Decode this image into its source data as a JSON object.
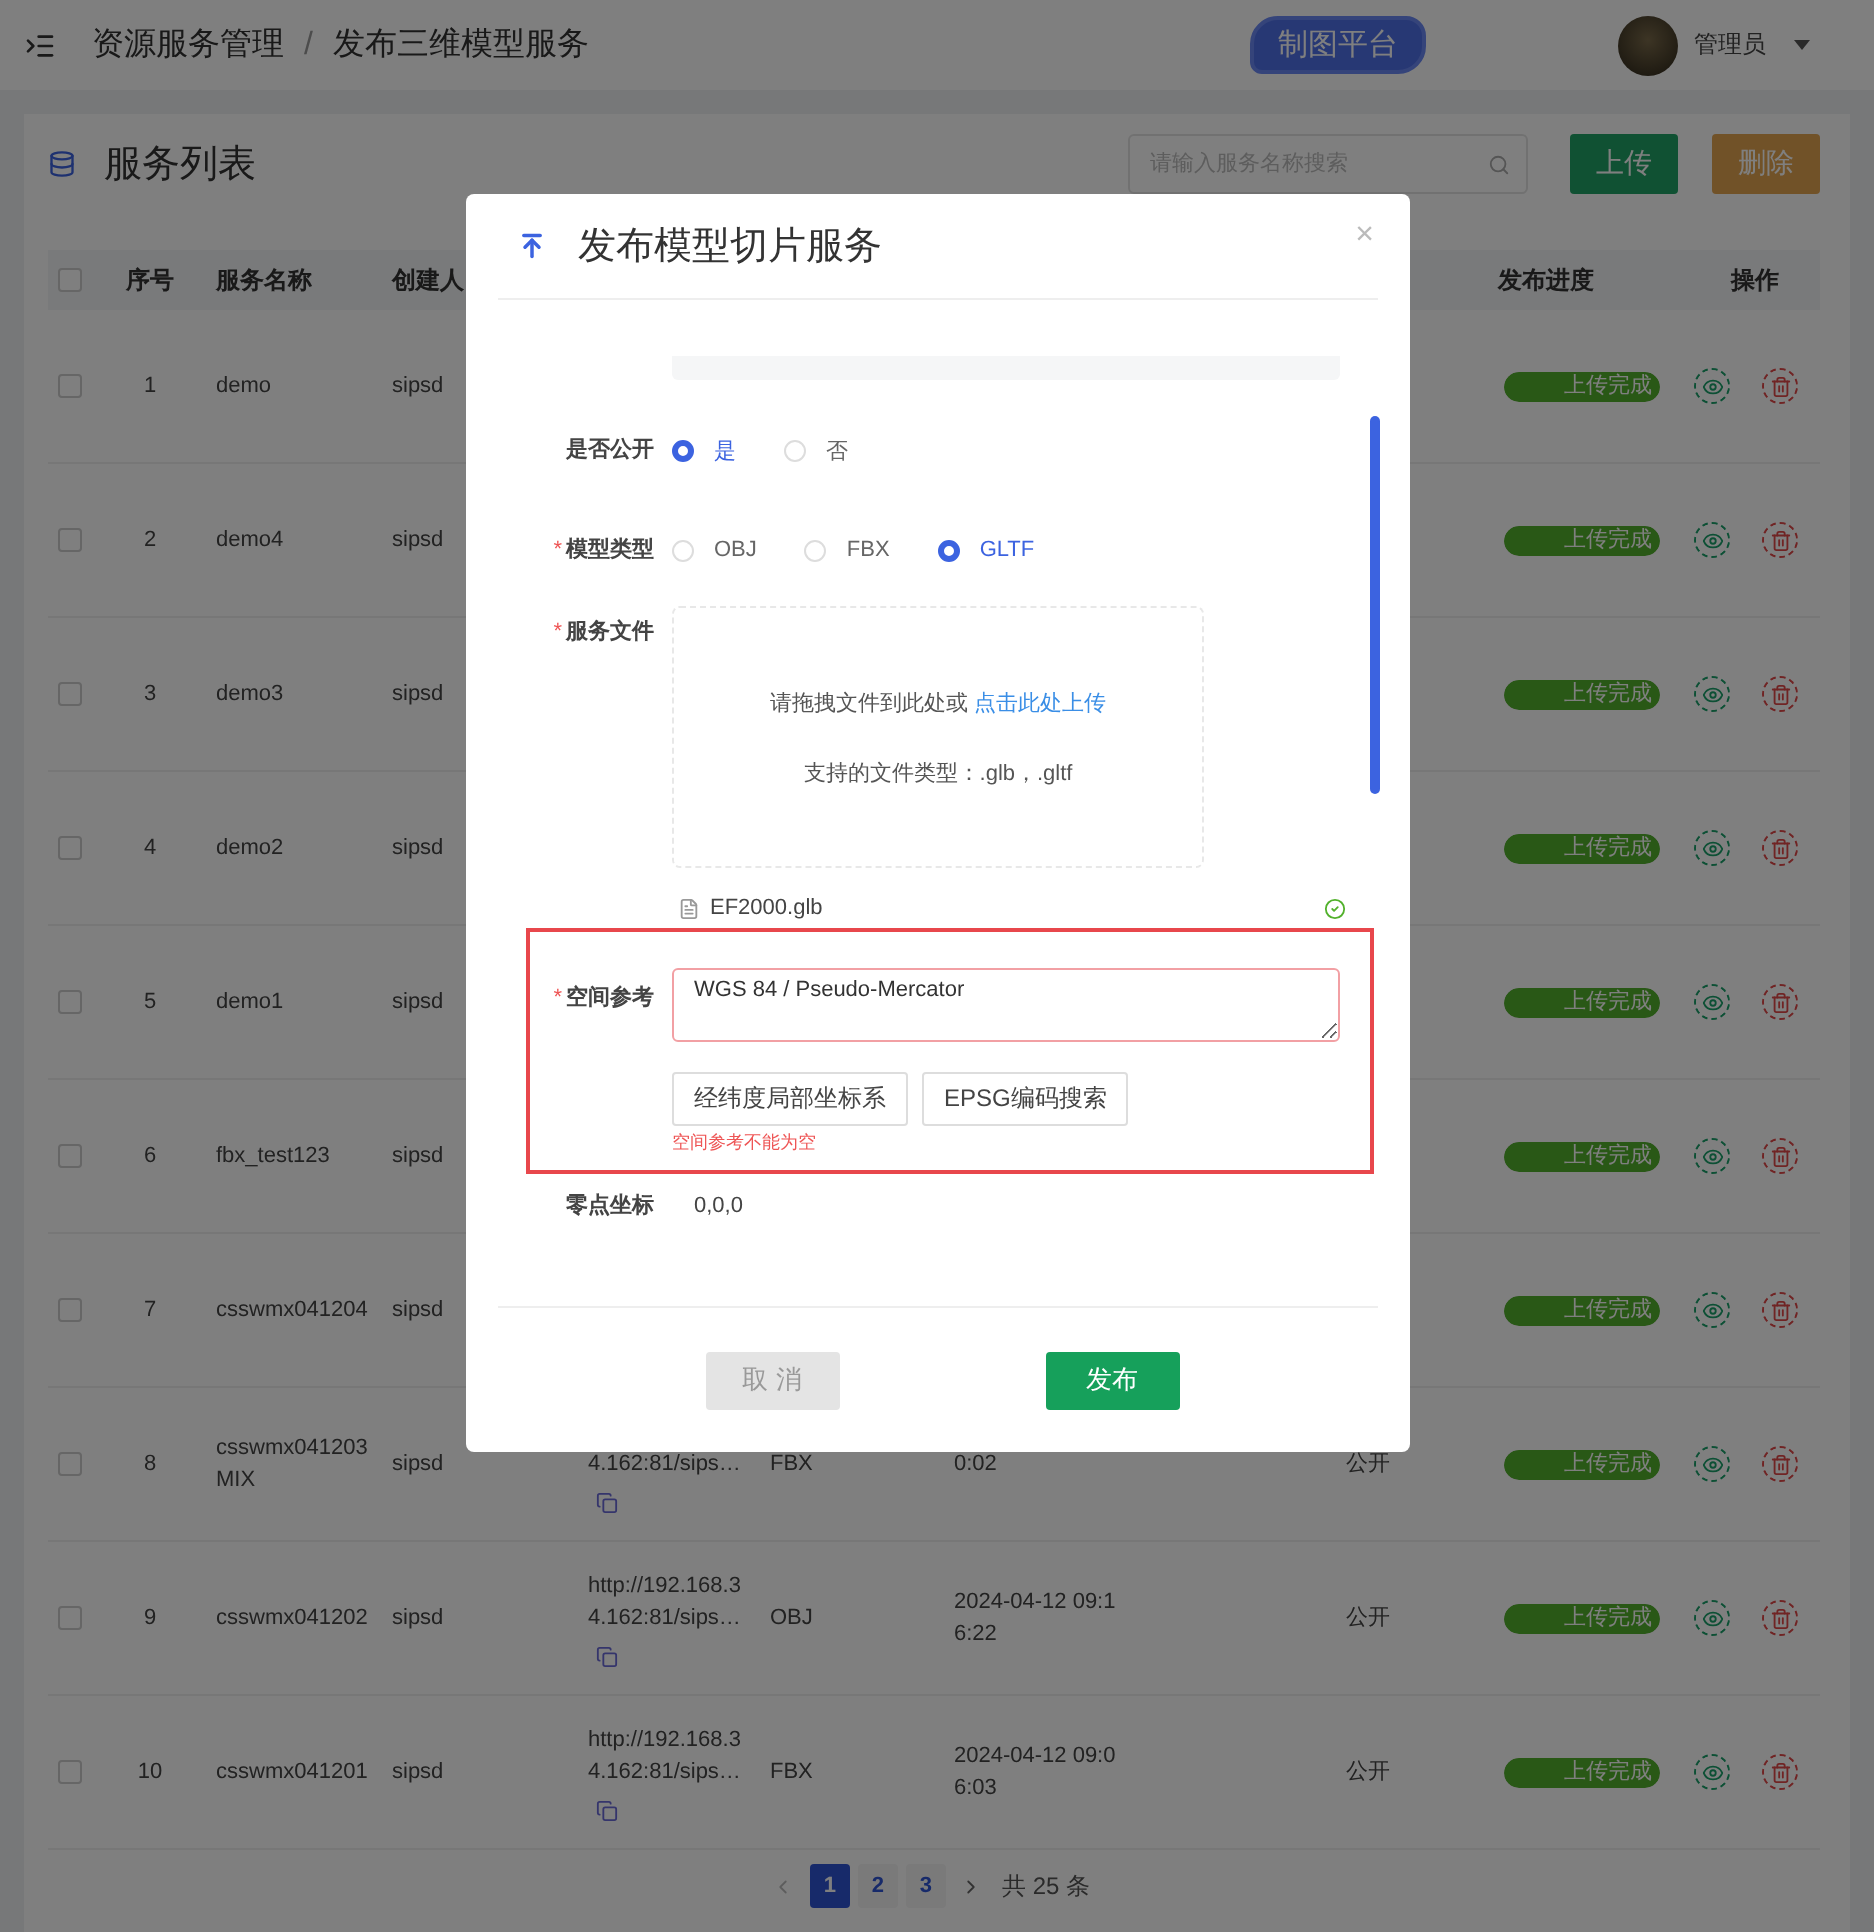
{
  "header": {
    "breadcrumb": [
      "资源服务管理",
      "发布三维模型服务"
    ],
    "separator": "/",
    "platform_button": "制图平台",
    "user": "管理员"
  },
  "card": {
    "title": "服务列表",
    "search": {
      "placeholder": "请输入服务名称搜索"
    },
    "buttons": [
      {
        "label": "上传",
        "kind": "primary",
        "disabled": false
      },
      {
        "label": "删除",
        "kind": "danger",
        "disabled": true
      }
    ]
  },
  "table": {
    "header_checked": false,
    "columns": [
      "序号",
      "服务名称",
      "创建人",
      "发布进度",
      "操作"
    ],
    "rows": [
      {
        "seq": "1",
        "name": "demo",
        "creator": "sipsd",
        "checked": false,
        "progress": {
          "label": "上传完成",
          "level": 1
        }
      },
      {
        "seq": "2",
        "name": "demo4",
        "creator": "sipsd",
        "checked": false,
        "progress": {
          "label": "上传完成",
          "level": 1
        }
      },
      {
        "seq": "3",
        "name": "demo3",
        "creator": "sipsd",
        "checked": false,
        "progress": {
          "label": "上传完成",
          "level": 1
        }
      },
      {
        "seq": "4",
        "name": "demo2",
        "creator": "sipsd",
        "checked": false,
        "progress": {
          "label": "上传完成",
          "level": 1
        }
      },
      {
        "seq": "5",
        "name": "demo1",
        "creator": "sipsd",
        "checked": false,
        "progress": {
          "label": "上传完成",
          "level": 1
        }
      },
      {
        "seq": "6",
        "name": "fbx_test123",
        "creator": "sipsd",
        "checked": false,
        "progress": {
          "label": "上传完成",
          "level": 1
        }
      },
      {
        "seq": "7",
        "name": "csswmx041204",
        "creator": "sipsd",
        "checked": false,
        "progress": {
          "label": "上传完成",
          "level": 1
        }
      },
      {
        "seq": "8",
        "name": "csswmx041203MIX",
        "creator": "sipsd",
        "checked": false,
        "url": "4.162:81/sips…",
        "type": "FBX",
        "time": "0:02",
        "public": "公开",
        "progress": {
          "label": "上传完成",
          "level": 1
        }
      },
      {
        "seq": "9",
        "name": "csswmx041202",
        "creator": "sipsd",
        "checked": false,
        "url": "http://192.168.34.162:81/sips…",
        "type": "OBJ",
        "time": "2024-04-12 09:16:22",
        "public": "公开",
        "progress": {
          "label": "上传完成",
          "level": 1
        }
      },
      {
        "seq": "10",
        "name": "csswmx041201",
        "creator": "sipsd",
        "checked": false,
        "url": "http://192.168.34.162:81/sips…",
        "type": "FBX",
        "time": "2024-04-12 09:06:03",
        "public": "公开",
        "progress": {
          "label": "上传完成",
          "level": 1
        }
      }
    ]
  },
  "pagination": {
    "pages": [
      {
        "label": "1",
        "selected": true
      },
      {
        "label": "2",
        "selected": false
      },
      {
        "label": "3",
        "selected": false
      }
    ],
    "total": "共 25 条"
  },
  "modal": {
    "title": "发布模型切片服务",
    "close": "×",
    "public_field": {
      "label": "是否公开",
      "options": [
        {
          "label": "是",
          "selected": true
        },
        {
          "label": "否",
          "selected": false
        }
      ]
    },
    "type_field": {
      "label": "模型类型",
      "required_mark": "*",
      "options": [
        {
          "label": "OBJ",
          "selected": false
        },
        {
          "label": "FBX",
          "selected": false
        },
        {
          "label": "GLTF",
          "selected": true
        }
      ]
    },
    "file_field": {
      "label": "服务文件",
      "required_mark": "*",
      "hint": "请拖拽文件到此处或 ",
      "link": "点击此处上传",
      "types": "支持的文件类型：.glb，.gltf",
      "files": [
        {
          "name": "EF2000.glb",
          "done": true
        }
      ]
    },
    "srs_field": {
      "label": "空间参考",
      "required_mark": "*",
      "highlighted": true,
      "value": "WGS 84 / Pseudo-Mercator",
      "buttons": [
        "经纬度局部坐标系",
        "EPSG编码搜索"
      ],
      "error": "空间参考不能为空"
    },
    "origin_field": {
      "label": "零点坐标",
      "value": "0,0,0"
    },
    "footer": [
      {
        "label": "取 消",
        "kind": "cancel",
        "disabled": true
      },
      {
        "label": "发布",
        "kind": "primary"
      }
    ]
  }
}
